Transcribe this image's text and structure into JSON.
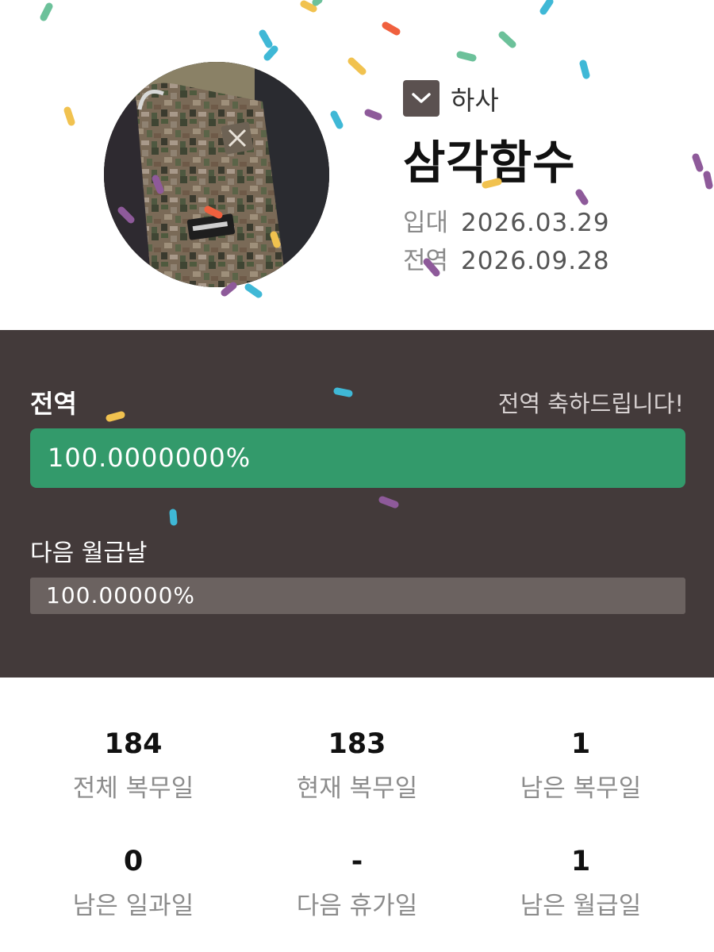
{
  "profile": {
    "rank": "하사",
    "name": "삼각함수",
    "enlist_label": "입대",
    "enlist_date": "2026.03.29",
    "discharge_label": "전역",
    "discharge_date": "2026.09.28"
  },
  "progress": {
    "title": "전역",
    "message": "전역 축하드립니다!",
    "value_text": "100.0000000%",
    "fraction": 1.0,
    "pay_title": "다음 월급날",
    "pay_value_text": "100.00000%",
    "pay_fraction": 1.0
  },
  "stats": [
    {
      "value": "184",
      "label": "전체 복무일"
    },
    {
      "value": "183",
      "label": "현재 복무일"
    },
    {
      "value": "1",
      "label": "남은 복무일"
    },
    {
      "value": "0",
      "label": "남은 일과일"
    },
    {
      "value": "-",
      "label": "다음 휴가일"
    },
    {
      "value": "1",
      "label": "남은 월급일"
    }
  ],
  "colors": {
    "panel_bg": "#433a3a",
    "progress_fill": "#339a6b",
    "pay_fill": "#6b6260",
    "rank_toggle": "#5b5150"
  },
  "icons": {
    "rank_toggle": "chevron-down-icon"
  }
}
